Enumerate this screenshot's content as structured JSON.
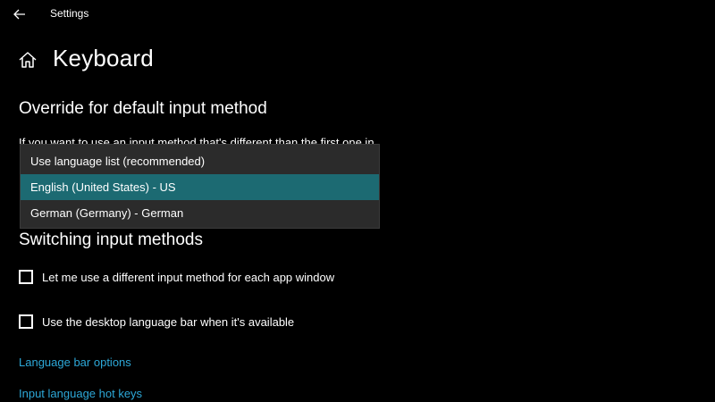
{
  "window": {
    "title": "Settings"
  },
  "page": {
    "title": "Keyboard"
  },
  "override_section": {
    "title": "Override for default input method",
    "description": "If you want to use an input method that's different than the first one in",
    "dropdown": {
      "options": [
        "Use language list (recommended)",
        "English (United States) - US",
        "German (Germany) - German"
      ],
      "selected": "English (United States) - US"
    }
  },
  "switching_section": {
    "title": "Switching input methods",
    "checkboxes": [
      {
        "label": "Let me use a different input method for each app window",
        "checked": false
      },
      {
        "label": "Use the desktop language bar when it's available",
        "checked": false
      }
    ]
  },
  "links": {
    "language_bar_options": "Language bar options",
    "input_language_hot_keys": "Input language hot keys"
  },
  "colors": {
    "background": "#000000",
    "accent_selection": "#1c6a72",
    "dropdown_bg": "#2b2b2b",
    "link": "#2da8d8"
  },
  "icons": [
    "back-arrow-icon",
    "home-icon"
  ]
}
